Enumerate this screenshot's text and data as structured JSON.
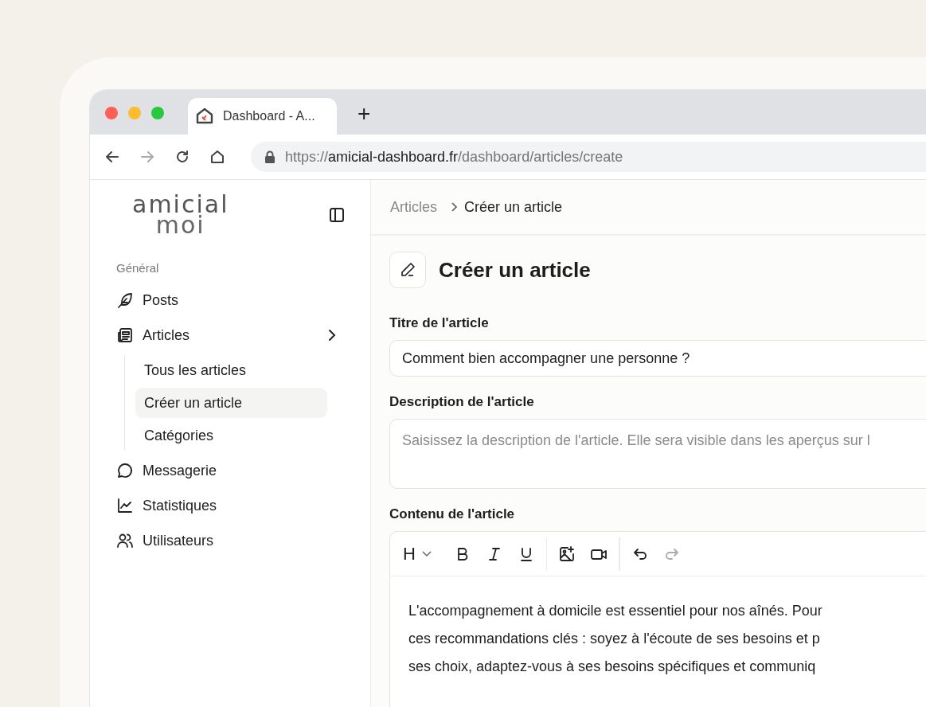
{
  "browser": {
    "tab_title": "Dashboard - A...",
    "new_tab": "+",
    "nav": [
      {
        "kind": "back",
        "disabled": false
      },
      {
        "kind": "forward",
        "disabled": true
      },
      {
        "kind": "reload",
        "disabled": false
      },
      {
        "kind": "home",
        "disabled": false
      }
    ],
    "url": {
      "scheme": "https://",
      "host": "amicial-dashboard.fr",
      "path": "/dashboard/articles/create"
    }
  },
  "logo": {
    "line_1": "amicial",
    "line_2": "moi"
  },
  "sidebar": {
    "section": "Général",
    "items": [
      {
        "label": "Posts"
      },
      {
        "label": "Articles",
        "expanded": true,
        "children": [
          {
            "label": "Tous les articles",
            "selected": false
          },
          {
            "label": "Créer un article",
            "selected": true
          },
          {
            "label": "Catégories",
            "selected": false
          }
        ]
      },
      {
        "label": "Messagerie"
      },
      {
        "label": "Statistiques"
      },
      {
        "label": "Utilisateurs"
      }
    ]
  },
  "breadcrumbs": [
    "Articles",
    "Créer un article"
  ],
  "page_title": "Créer un article",
  "form": {
    "title_label": "Titre de l'article",
    "title_value": "Comment bien accompagner une personne ?",
    "description_label": "Description de l'article",
    "description_placeholder": "Saisissez la description de l'article. Elle sera visible dans les aperçus sur l",
    "content_label": "Contenu de l'article",
    "toolbar": [
      {
        "kind": "heading",
        "text": "H",
        "disabled": false
      },
      {
        "kind": "bold",
        "disabled": false
      },
      {
        "kind": "italic",
        "disabled": false
      },
      {
        "kind": "underline",
        "disabled": false
      },
      {
        "kind": "separator"
      },
      {
        "kind": "image",
        "disabled": false
      },
      {
        "kind": "video",
        "disabled": false
      },
      {
        "kind": "separator"
      },
      {
        "kind": "undo",
        "disabled": false
      },
      {
        "kind": "redo",
        "disabled": true
      }
    ],
    "content_lines": [
      "L'accompagnement à domicile est essentiel pour nos aînés. Pour",
      "ces recommandations clés : soyez à l'écoute de ses besoins et p",
      "ses choix, adaptez-vous à ses besoins spécifiques et communiq"
    ]
  }
}
